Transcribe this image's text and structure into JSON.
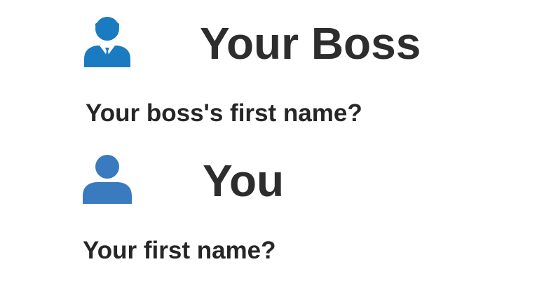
{
  "boss_section": {
    "icon": "businessman-icon",
    "heading": "Your Boss",
    "question": "Your boss's first name?",
    "icon_color": "#1B7BC0"
  },
  "you_section": {
    "icon": "user-icon",
    "heading": "You",
    "question": "Your first name?",
    "icon_color": "#3A7ABF"
  }
}
